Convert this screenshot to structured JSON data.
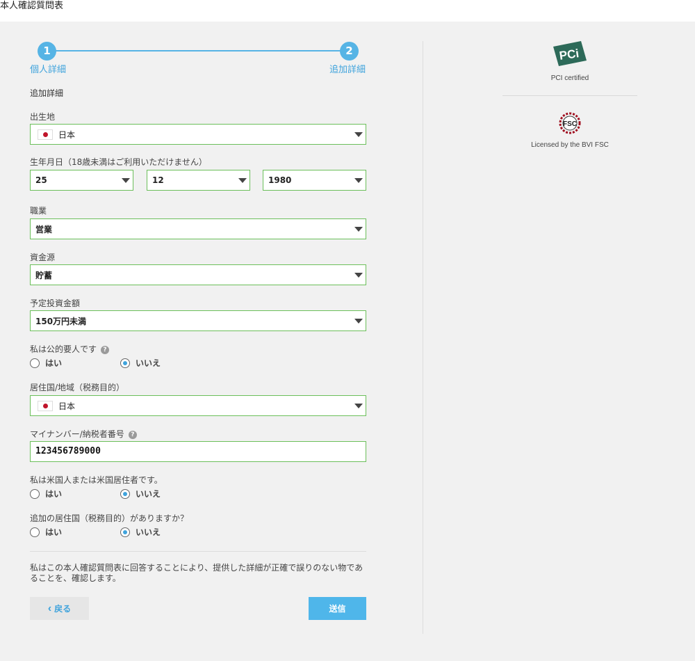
{
  "page": {
    "title": "本人確認質問表"
  },
  "stepper": {
    "steps": [
      {
        "number": "1",
        "label": "個人詳細"
      },
      {
        "number": "2",
        "label": "追加詳細"
      }
    ]
  },
  "form": {
    "section_title": "追加詳細",
    "birthplace": {
      "label": "出生地",
      "value": "日本"
    },
    "dob": {
      "label": "生年月日（18歳未満はご利用いただけません）",
      "day": "25",
      "month": "12",
      "year": "1980"
    },
    "occupation": {
      "label": "職業",
      "value": "営業"
    },
    "source_of_funds": {
      "label": "資金源",
      "value": "貯蓄"
    },
    "planned_investment": {
      "label": "予定投資金額",
      "value": "150万円未満"
    },
    "pep": {
      "label": "私は公的要人です",
      "yes": "はい",
      "no": "いいえ",
      "selected": "no"
    },
    "tax_residence": {
      "label": "居住国/地域（税務目的）",
      "value": "日本"
    },
    "tax_number": {
      "label": "マイナンバー/納税者番号",
      "value": "123456789000"
    },
    "us_person": {
      "label": "私は米国人または米国居住者です。",
      "yes": "はい",
      "no": "いいえ",
      "selected": "no"
    },
    "additional_residence": {
      "label": "追加の居住国（税務目的）がありますか？",
      "yes": "はい",
      "no": "いいえ",
      "selected": "no"
    },
    "confirmation_text": "私はこの本人確認質問表に回答することにより、提供した詳細が正確で誤りのない物であることを、確認します。",
    "back_label": "戻る",
    "submit_label": "送信",
    "help_glyph": "?"
  },
  "badges": [
    {
      "icon": "pci-logo-icon",
      "caption": "PCI certified",
      "logo_text": "PCi"
    },
    {
      "icon": "fsc-logo-icon",
      "caption": "Licensed by the BVI FSC",
      "logo_text": "FSC"
    }
  ],
  "colors": {
    "accent": "#56b4e5",
    "field_border": "#6bbf5a",
    "submit": "#4fb6ea",
    "flag_red": "#c0142a"
  }
}
